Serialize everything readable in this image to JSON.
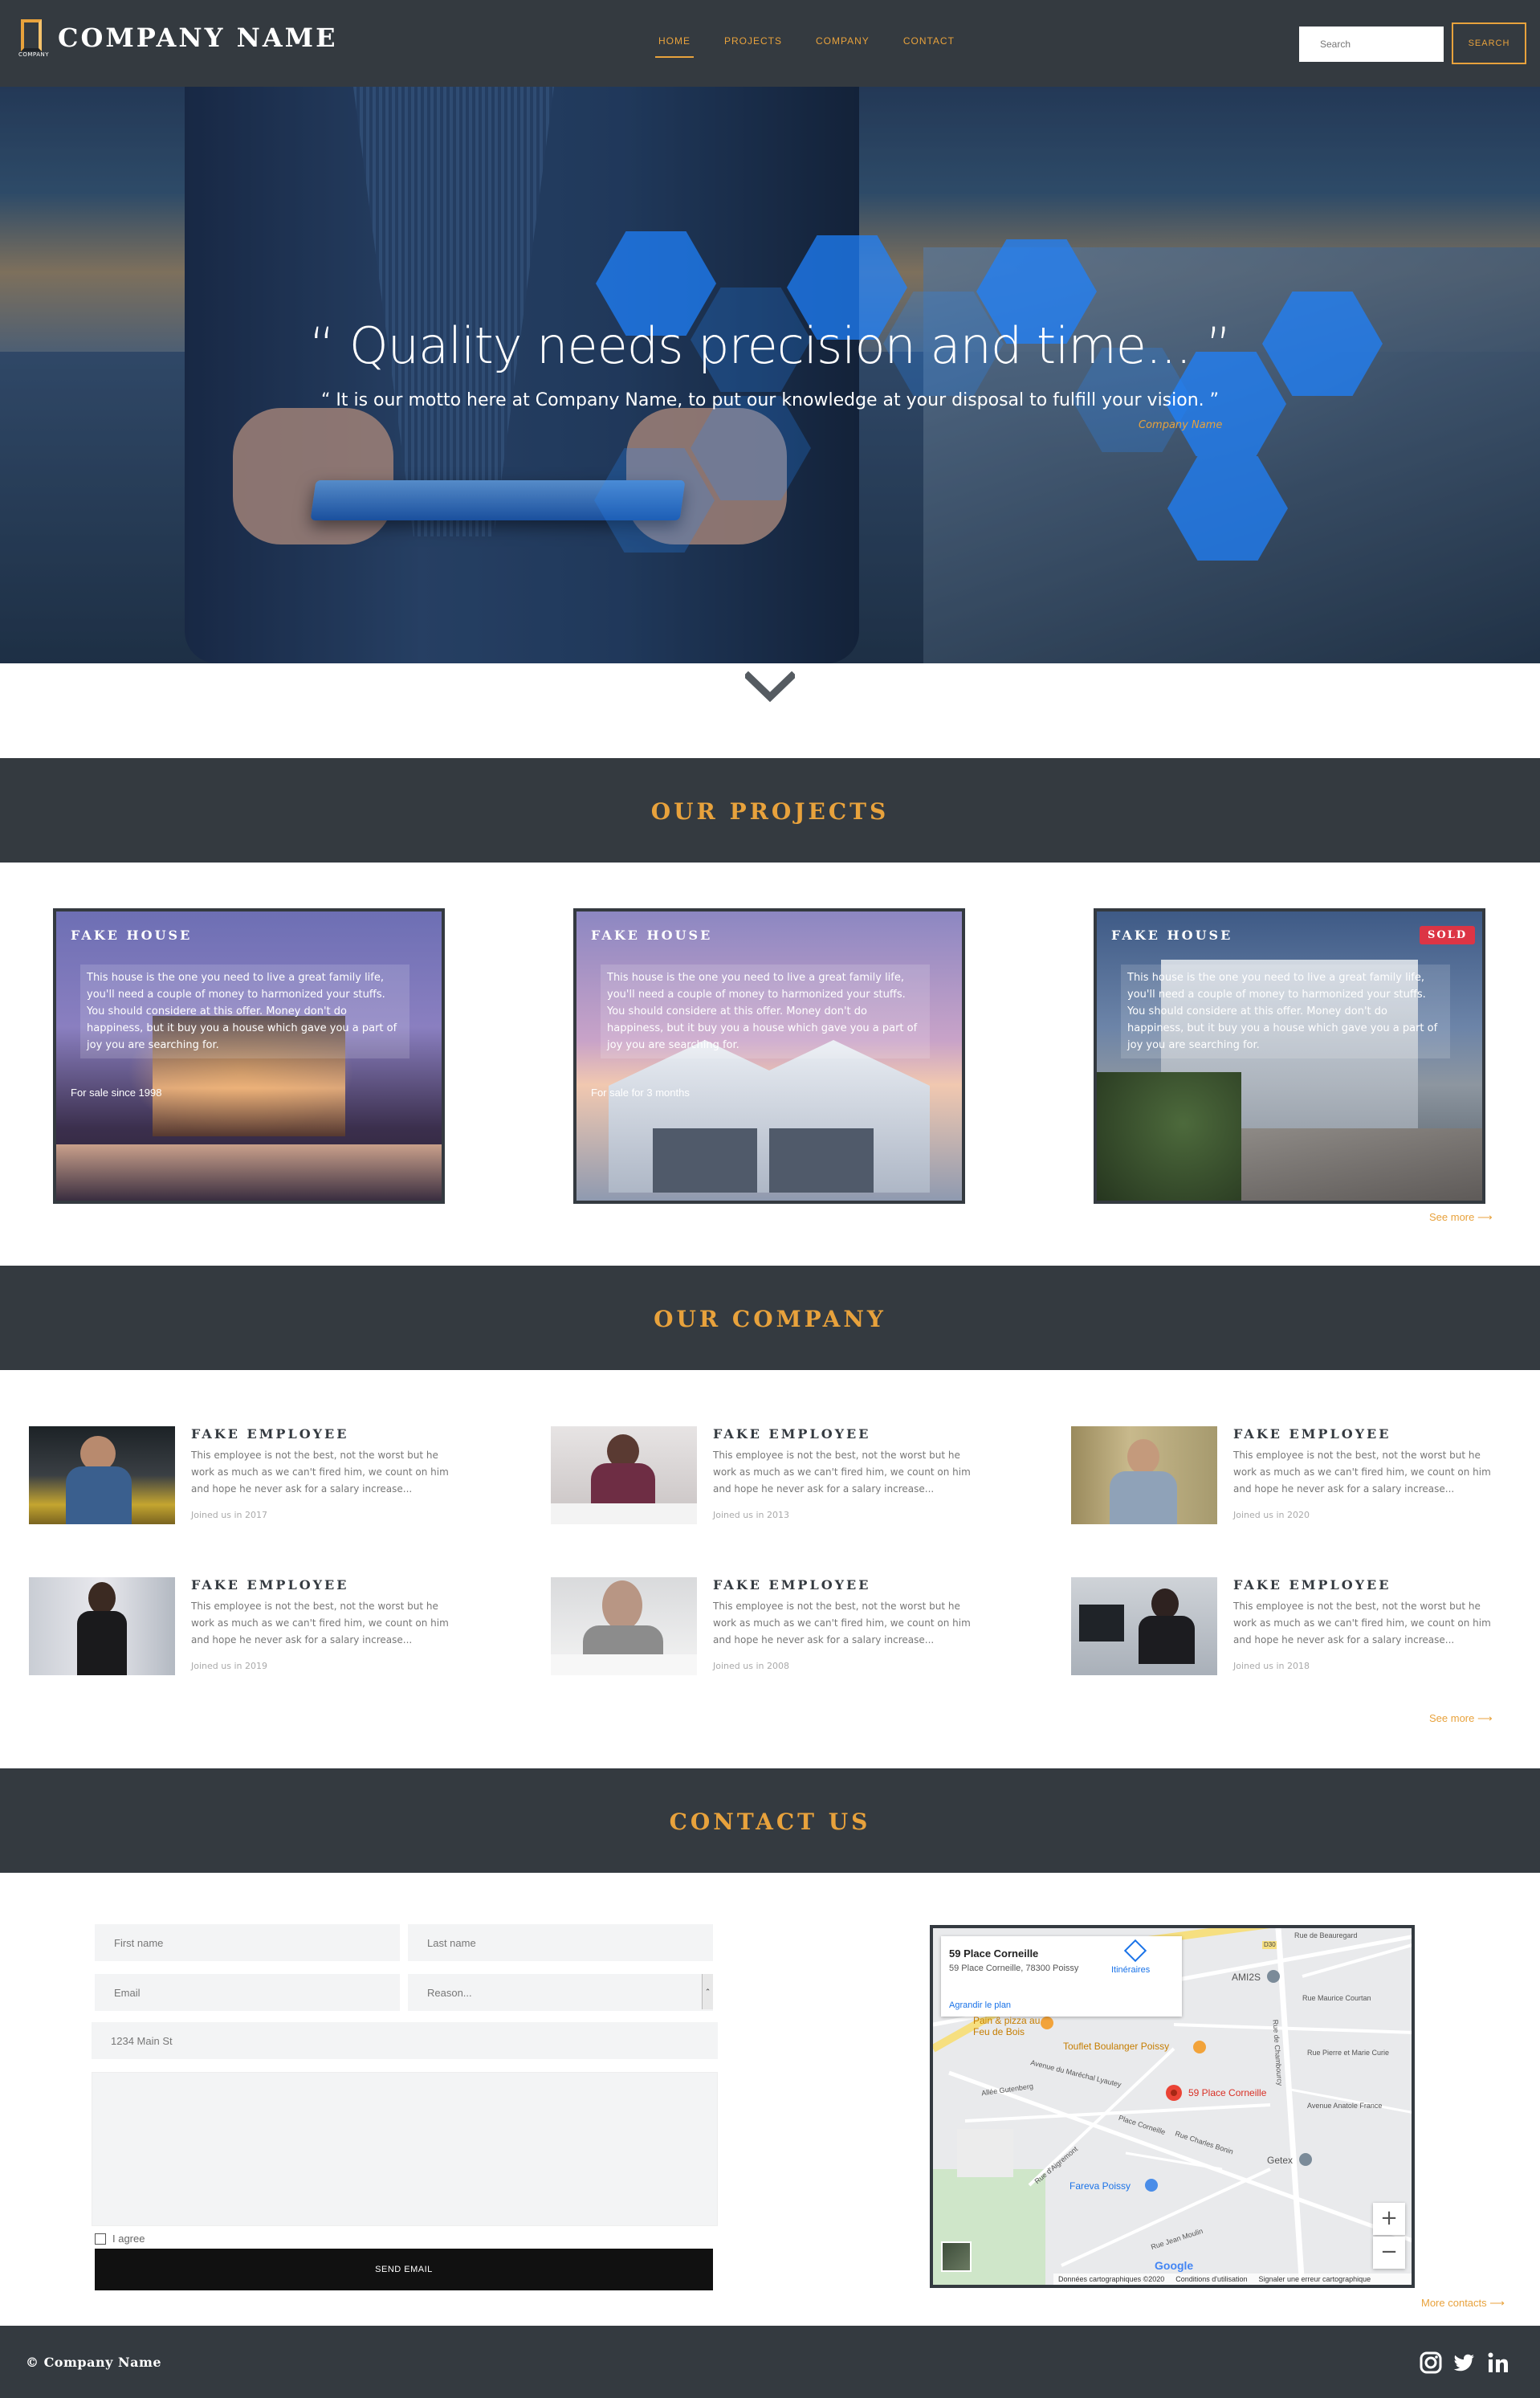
{
  "navbar": {
    "logo_text": "COMPANY",
    "brand": "COMPANY NAME",
    "links": [
      "HOME",
      "PROJECTS",
      "COMPANY",
      "CONTACT"
    ],
    "active_link": "HOME",
    "search_placeholder": "Search",
    "search_button": "SEARCH"
  },
  "hero": {
    "quote": "“ Quality needs precision and time... ”",
    "subquote": "“ It is our motto here at Company Name, to put our knowledge at your disposal to fulfill your vision. ”",
    "signature": "Company Name"
  },
  "projects": {
    "title": "OUR PROJECTS",
    "cards": [
      {
        "title": "FAKE HOUSE",
        "text": "This house is the one you need to live a great family life, you'll need a couple of money to harmonized your stuffs. You should considere at this offer. Money don't do happiness, but it buy you a house which gave you a part of joy you are searching for.",
        "footer": "For sale since 1998",
        "badge": ""
      },
      {
        "title": "FAKE HOUSE",
        "text": "This house is the one you need to live a great family life, you'll need a couple of money to harmonized your stuffs. You should considere at this offer. Money don't do happiness, but it buy you a house which gave you a part of joy you are searching for.",
        "footer": "For sale for 3 months",
        "badge": ""
      },
      {
        "title": "FAKE HOUSE",
        "text": "This house is the one you need to live a great family life, you'll need a couple of money to harmonized your stuffs. You should considere at this offer. Money don't do happiness, but it buy you a house which gave you a part of joy you are searching for.",
        "footer": "",
        "badge": "SOLD"
      }
    ],
    "see_more": "See more ⟶"
  },
  "company": {
    "title": "OUR COMPANY",
    "employees": [
      {
        "name": "FAKE EMPLOYEE",
        "desc": "This employee is not the best, not the worst but he work as much as we can't fired him, we count on him and hope he never ask for a salary increase...",
        "joined": "Joined us in 2017"
      },
      {
        "name": "FAKE EMPLOYEE",
        "desc": "This employee is not the best, not the worst but he work as much as we can't fired him, we count on him and hope he never ask for a salary increase...",
        "joined": "Joined us in 2013"
      },
      {
        "name": "FAKE EMPLOYEE",
        "desc": "This employee is not the best, not the worst but he work as much as we can't fired him, we count on him and hope he never ask for a salary increase...",
        "joined": "Joined us in 2020"
      },
      {
        "name": "FAKE EMPLOYEE",
        "desc": "This employee is not the best, not the worst but he work as much as we can't fired him, we count on him and hope he never ask for a salary increase...",
        "joined": "Joined us in 2019"
      },
      {
        "name": "FAKE EMPLOYEE",
        "desc": "This employee is not the best, not the worst but he work as much as we can't fired him, we count on him and hope he never ask for a salary increase...",
        "joined": "Joined us in 2008"
      },
      {
        "name": "FAKE EMPLOYEE",
        "desc": "This employee is not the best, not the worst but he work as much as we can't fired him, we count on him and hope he never ask for a salary increase...",
        "joined": "Joined us in 2018"
      }
    ],
    "see_more": "See more ⟶"
  },
  "contact": {
    "title": "CONTACT US",
    "first_name": "First name",
    "last_name": "Last name",
    "email": "Email",
    "reason": "Reason...",
    "address": "1234 Main St",
    "agree": "I agree",
    "send": "SEND EMAIL",
    "more_contacts": "More contacts ⟶",
    "map": {
      "place_title": "59 Place Corneille",
      "place_address": "59 Place Corneille, 78300 Poissy",
      "directions": "Itinéraires",
      "enlarge": "Agrandir le plan",
      "pin_label": "59 Place Corneille",
      "poi_pizza": "Pain & pizza au Feu de Bois",
      "poi_bakery": "Touflet Boulanger Poissy",
      "poi_amis": "AMI2S",
      "poi_getex": "Getex",
      "poi_fareva": "Fareva Poissy",
      "streets": [
        "Rue de Beauregard",
        "Rue Maurice Courtan",
        "Rue de Chambourcy",
        "Rue Pierre et Marie Curie",
        "Avenue Anatole France",
        "Allée Gutenberg",
        "Avenue du Maréchal Lyautey",
        "Place Corneille",
        "Rue Charles Bonin",
        "Rue Jean Moulin",
        "Rue d'Aigremont"
      ],
      "road_code": "D30",
      "footer_data": "Données cartographiques ©2020",
      "footer_terms": "Conditions d'utilisation",
      "footer_report": "Signaler une erreur cartographique",
      "google": "Google"
    }
  },
  "footer": {
    "copyright": "© Company Name",
    "social": [
      "instagram-icon",
      "twitter-icon",
      "linkedin-icon"
    ]
  },
  "colors": {
    "dark": "#343a40",
    "accent": "#e8a23c",
    "sold": "#dc3545"
  }
}
